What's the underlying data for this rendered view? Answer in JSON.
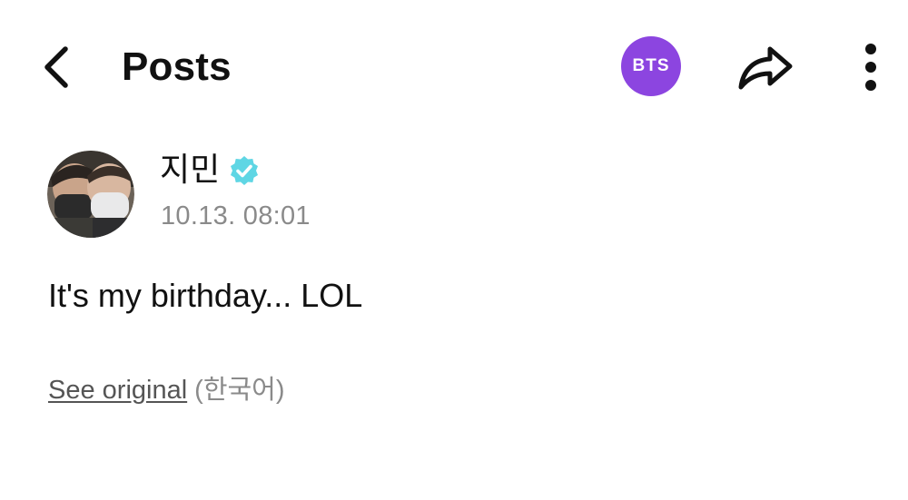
{
  "header": {
    "title": "Posts",
    "back_icon": "chevron-left-icon",
    "community_badge": {
      "label": "BTS",
      "color": "#8c45e0"
    },
    "share_icon": "share-arrow-icon",
    "more_icon": "kebab-menu-icon"
  },
  "post": {
    "author": {
      "name": "지민",
      "verified": true,
      "verified_color": "#5fd6e4",
      "avatar_icon": "avatar-photo"
    },
    "timestamp": "10.13. 08:01",
    "body": "It's my birthday... LOL",
    "translation": {
      "link_label": "See original",
      "language_note": "(한국어)"
    }
  }
}
